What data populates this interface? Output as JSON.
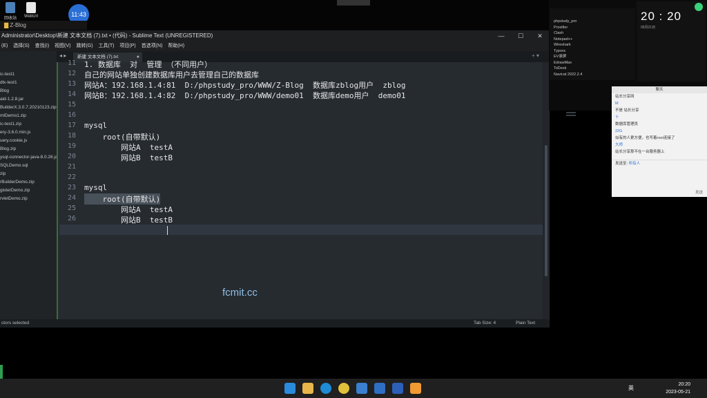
{
  "desktop": {
    "icons": [
      {
        "label": "回收站"
      },
      {
        "label": "WebUrl"
      }
    ],
    "clock_bubble": "11:43",
    "explorer_title": "Z-Blog"
  },
  "sublime": {
    "title": "Administrator\\Desktop\\新建 文本文档 (7).txt • (代码) - Sublime Text (UNREGISTERED)",
    "menu": [
      "(E)",
      "选择(S)",
      "查找(I)",
      "视图(V)",
      "跳转(G)",
      "工具(T)",
      "项目(P)",
      "首选项(N)",
      "帮助(H)"
    ],
    "tab_label": "新建 文本文档 (7).txt",
    "sidebar_files": [
      "ic-test1",
      "dlx-test1",
      "Blog",
      "aid-1.2.8.jar",
      "BuilderX.3.0.7.20210123.zip",
      "mlDemo1.zip",
      "ic-test1.zip",
      "ery-3.6.0.min.js",
      "uery.cookie.js",
      "Blog.zip",
      "ysql-connector-java-8.0.26.jar",
      "SQLDemo.sql",
      "zip",
      "rBuilderDemo.zip",
      "gisterDemo.zip",
      "rvletDemo.zip"
    ],
    "lines": [
      {
        "num": "11",
        "text": "1. 数据库  对  管理 （不同用户）"
      },
      {
        "num": "12",
        "text": "自己的网站单独创建数据库用户去管理自己的数据库"
      },
      {
        "num": "13",
        "text": "网站A：192.168.1.4:81  D:/phpstudy_pro/WWW/Z-Blog  数据库zblog用户  zblog"
      },
      {
        "num": "14",
        "text": "网站B：192.168.1.4:82  D:/phpstudy_pro/WWW/demo01  数据库demo用户  demo01"
      },
      {
        "num": "15",
        "text": ""
      },
      {
        "num": "16",
        "text": ""
      },
      {
        "num": "17",
        "text": "mysql"
      },
      {
        "num": "18",
        "text": "    root(自带默认)"
      },
      {
        "num": "19",
        "text": "        网站A  testA"
      },
      {
        "num": "20",
        "text": "        网站B  testB"
      },
      {
        "num": "21",
        "text": ""
      },
      {
        "num": "22",
        "text": ""
      },
      {
        "num": "23",
        "text": "mysql"
      },
      {
        "num": "24",
        "text": "    root(自带默认)"
      },
      {
        "num": "25",
        "text": "        网站A  testA"
      },
      {
        "num": "26",
        "text": "        网站B  testB"
      }
    ],
    "status_left": "ctors selected",
    "status_tab": "Tab Size: 4",
    "status_syntax": "Plain Text",
    "watermark": "fcmit.cc"
  },
  "right_panel": {
    "apps": [
      "phpstudy_pro",
      "Proxifier",
      "Clash",
      "Notepad++",
      "Wireshark",
      "Typora",
      "EV录屏",
      "EdrawMax",
      "ToDesk",
      "Navicat 2022.2.4"
    ],
    "time": "20 : 20",
    "date_small": "05月21日"
  },
  "chat": {
    "title": "聊天",
    "messages": [
      "站长分享网",
      "M",
      "不是 站长分享",
      "十",
      "数据库管理员",
      "22G",
      "似有的人更方便，也写着root连接了",
      "大师",
      "站长分享那不在一台服务器上"
    ],
    "input_placeholder": "发送至",
    "recipient": "所有人",
    "send": "发送"
  },
  "taskbar": {
    "time": "20:20",
    "date": "2023-05-21",
    "lang": "英"
  },
  "colors": {
    "accent": "#2a6fd6",
    "editor_bg": "#262b30",
    "git_bar": "#3b6e3a",
    "watermark": "#8fbfe8"
  }
}
